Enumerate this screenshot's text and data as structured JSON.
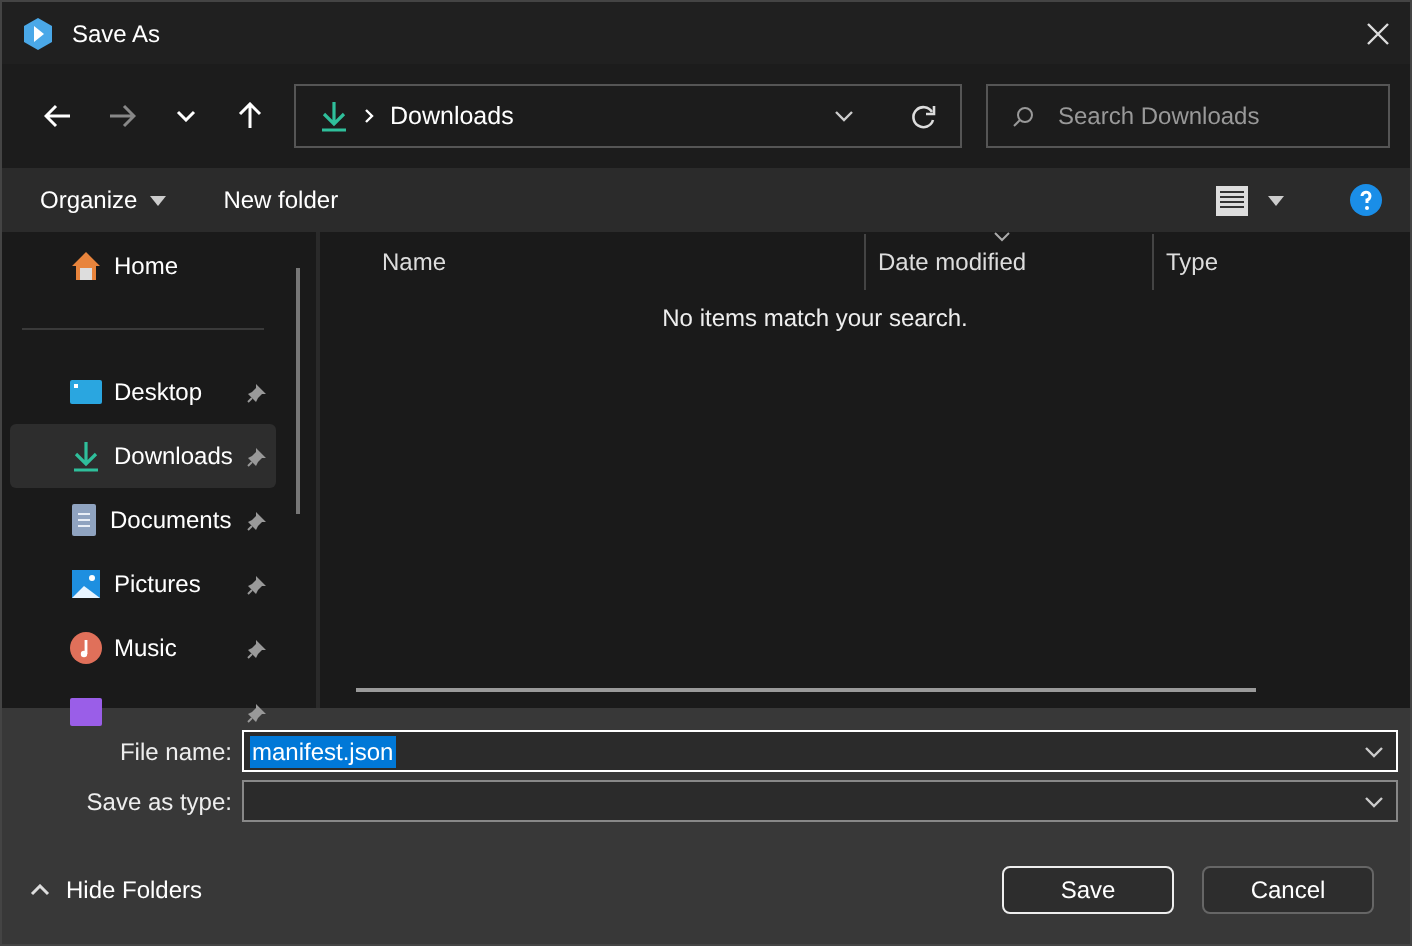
{
  "window": {
    "title": "Save As"
  },
  "nav": {
    "breadcrumb": "Downloads",
    "search": {
      "placeholder": "Search Downloads"
    }
  },
  "toolbar": {
    "buttons": [
      "Organize",
      "New folder"
    ]
  },
  "sidebar": {
    "items": [
      {
        "label": "Home",
        "kind": "home",
        "pinned": false,
        "selected": false
      },
      {
        "label": "Desktop",
        "kind": "desktop",
        "pinned": true,
        "selected": false
      },
      {
        "label": "Downloads",
        "kind": "downloads",
        "pinned": true,
        "selected": true
      },
      {
        "label": "Documents",
        "kind": "documents",
        "pinned": true,
        "selected": false
      },
      {
        "label": "Pictures",
        "kind": "pictures",
        "pinned": true,
        "selected": false
      },
      {
        "label": "Music",
        "kind": "music",
        "pinned": true,
        "selected": false
      },
      {
        "kind": "videos",
        "pinned": true,
        "selected": false
      }
    ]
  },
  "file_list": {
    "columns": [
      {
        "label": "Name",
        "sorted": false
      },
      {
        "label": "Date modified",
        "sorted": true
      },
      {
        "label": "Type",
        "sorted": false
      }
    ],
    "empty_message": "No items match your search."
  },
  "form": {
    "file_name": {
      "label": "File name:",
      "value": "manifest.json"
    },
    "save_as_type": {
      "label": "Save as type:"
    }
  },
  "hide_folders": "Hide Folders",
  "buttons": [
    {
      "label": "Save",
      "kind": "primary"
    },
    {
      "label": "Cancel",
      "kind": "secondary"
    }
  ]
}
